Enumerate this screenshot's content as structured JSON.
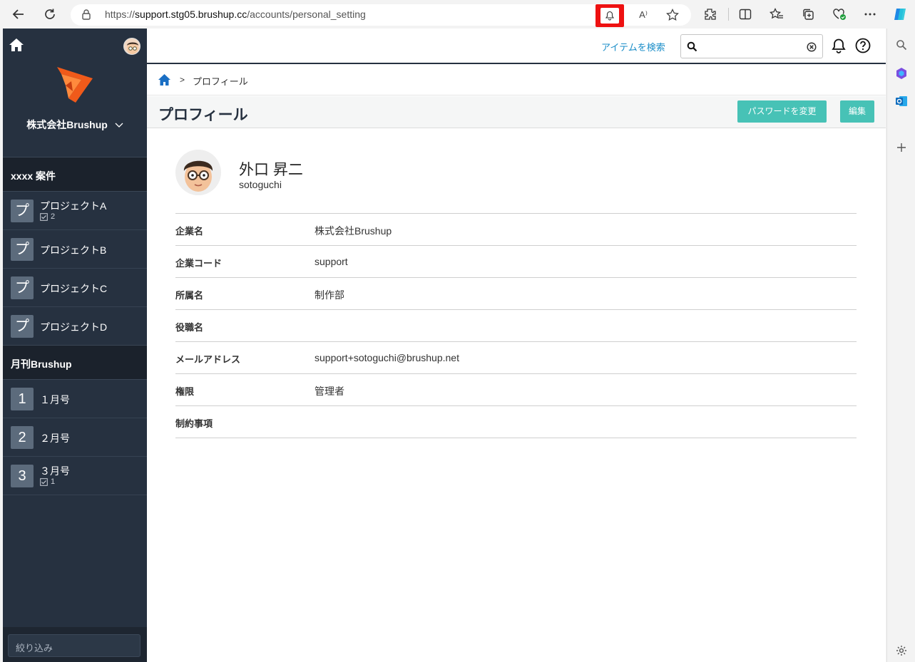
{
  "browser": {
    "url_prefix": "https://",
    "url_host": "support.stg05.brushup.cc",
    "url_path": "/accounts/personal_setting",
    "read_aloud_label": "A⁾"
  },
  "sidebar": {
    "company": "株式会社Brushup",
    "sections": [
      {
        "title": "xxxx 案件",
        "items": [
          {
            "badge": "プ",
            "label": "プロジェクトA",
            "count": "2"
          },
          {
            "badge": "プ",
            "label": "プロジェクトB"
          },
          {
            "badge": "プ",
            "label": "プロジェクトC"
          },
          {
            "badge": "プ",
            "label": "プロジェクトD"
          }
        ]
      },
      {
        "title": "月刊Brushup",
        "items": [
          {
            "badge": "1",
            "label": "１月号"
          },
          {
            "badge": "2",
            "label": "２月号"
          },
          {
            "badge": "3",
            "label": "３月号",
            "count": "1"
          }
        ]
      }
    ],
    "filter_placeholder": "絞り込み"
  },
  "header": {
    "search_link": "アイテムを検索",
    "search_value": ""
  },
  "breadcrumb": {
    "separator": ">",
    "current": "プロフィール"
  },
  "page": {
    "title": "プロフィール",
    "change_password_button": "パスワードを変更",
    "edit_button": "編集"
  },
  "profile": {
    "name": "外口 昇二",
    "username": "sotoguchi",
    "fields": [
      {
        "key": "企業名",
        "value": "株式会社Brushup"
      },
      {
        "key": "企業コード",
        "value": "support"
      },
      {
        "key": "所属名",
        "value": "制作部"
      },
      {
        "key": "役職名",
        "value": ""
      },
      {
        "key": "メールアドレス",
        "value": "support+sotoguchi@brushup.net"
      },
      {
        "key": "権限",
        "value": "管理者"
      },
      {
        "key": "制約事項",
        "value": ""
      }
    ]
  },
  "colors": {
    "sidebar_bg": "#263140",
    "accent_teal": "#47c2b6",
    "link_blue": "#1a8dc8",
    "highlight_red": "#ee1111",
    "logo_orange": "#f05a1a"
  }
}
